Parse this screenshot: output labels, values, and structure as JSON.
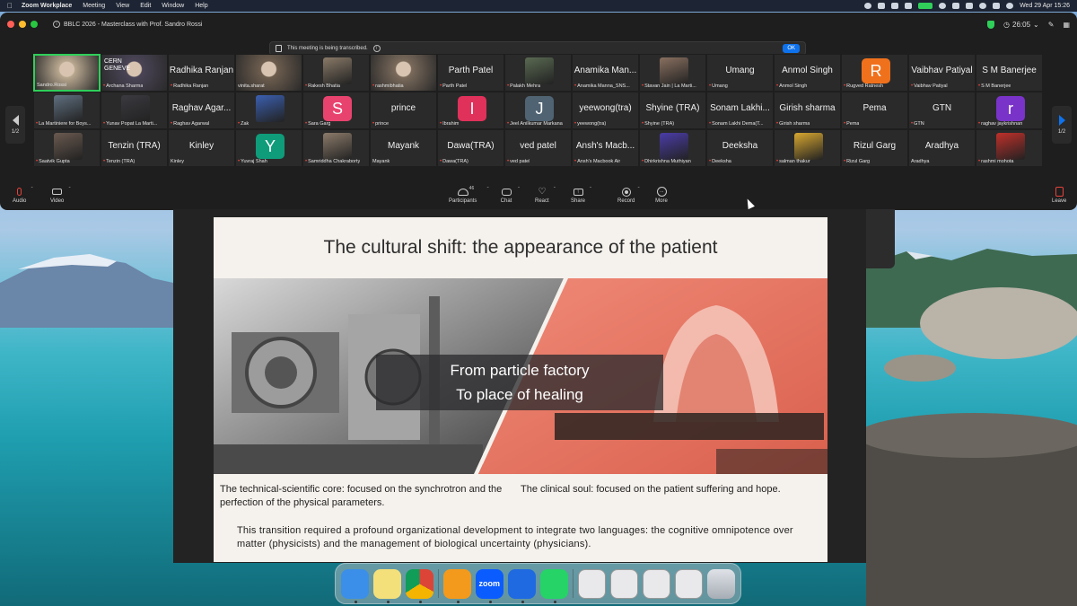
{
  "menubar": {
    "app": "Zoom Workplace",
    "items": [
      "Meeting",
      "View",
      "Edit",
      "Window",
      "Help"
    ],
    "datetime": "Wed 29 Apr  15:26"
  },
  "window": {
    "title": "BBLC 2026 - Masterclass with Prof. Sandro Rossi",
    "timer": "26:05"
  },
  "banner": {
    "text": "This meeting is being transcribed.",
    "ok": "OK"
  },
  "pager": {
    "left": "1/2",
    "right": "1/2"
  },
  "participants": [
    {
      "label": "Sandro.Rossi",
      "kind": "video",
      "color": "#b9a890",
      "active": true,
      "muted": false
    },
    {
      "label": "Archana Sharma",
      "kind": "video",
      "color": "#4a4456",
      "muted": true,
      "overlay": "CERN GENEVE"
    },
    {
      "label": "Radhika Ranjan",
      "kind": "name",
      "big": "Radhika Ranjan",
      "muted": true
    },
    {
      "label": "vinita.sharat",
      "kind": "video",
      "color": "#6d5d4e",
      "muted": false
    },
    {
      "label": "Rakesh Bhatia",
      "kind": "photo",
      "color": "#8a7a68",
      "muted": true
    },
    {
      "label": "rashmibhatia",
      "kind": "video",
      "color": "#7a6a5b",
      "muted": true
    },
    {
      "label": "Parth Patel",
      "kind": "name",
      "big": "Parth Patel",
      "muted": true
    },
    {
      "label": "Palakh Mehra",
      "kind": "photo",
      "color": "#5a6a52",
      "muted": true
    },
    {
      "label": "Anamika Manna_SNS...",
      "kind": "name",
      "big": "Anamika Man...",
      "muted": true
    },
    {
      "label": "Stavan Jain | La Marti...",
      "kind": "photo",
      "color": "#8a7060",
      "muted": true
    },
    {
      "label": "Umang",
      "kind": "name",
      "big": "Umang",
      "muted": true
    },
    {
      "label": "Anmol Singh",
      "kind": "name",
      "big": "Anmol Singh",
      "muted": true
    },
    {
      "label": "Rugved Ratnesh",
      "kind": "avatar",
      "letter": "R",
      "color": "#f0711c",
      "muted": true
    },
    {
      "label": "Vaibhav Patiyal",
      "kind": "name",
      "big": "Vaibhav Patiyal",
      "muted": true
    },
    {
      "label": "S M Banerjee",
      "kind": "name",
      "big": "S M Banerjee",
      "muted": true
    },
    {
      "label": "La Martiniere for Boys...",
      "kind": "photo",
      "color": "#5f6f80",
      "muted": true
    },
    {
      "label": "Yunav Popat La Marti...",
      "kind": "photo",
      "color": "#3a3a40",
      "muted": true
    },
    {
      "label": "Raghav Agarwal",
      "kind": "name",
      "big": "Raghav Agar...",
      "muted": true
    },
    {
      "label": "Zak",
      "kind": "photo",
      "color": "#3b5fb0",
      "muted": true
    },
    {
      "label": "Sara Garg",
      "kind": "avatar",
      "letter": "S",
      "color": "#e8436e",
      "muted": true
    },
    {
      "label": "prince",
      "kind": "name",
      "big": "prince",
      "muted": true
    },
    {
      "label": "Ibrahim",
      "kind": "avatar",
      "letter": "I",
      "color": "#e0315a",
      "muted": true
    },
    {
      "label": "Jeel Anilkumar Markana",
      "kind": "avatar",
      "letter": "J",
      "color": "#4f6373",
      "muted": true
    },
    {
      "label": "yeewong(tra)",
      "kind": "name",
      "big": "yeewong(tra)",
      "muted": true
    },
    {
      "label": "Shyine (TRA)",
      "kind": "name",
      "big": "Shyine (TRA)",
      "muted": true
    },
    {
      "label": "Sonam Lakhi Dema(T...",
      "kind": "name",
      "big": "Sonam Lakhi...",
      "muted": true
    },
    {
      "label": "Girish sharma",
      "kind": "name",
      "big": "Girish sharma",
      "muted": true
    },
    {
      "label": "Pema",
      "kind": "name",
      "big": "Pema",
      "muted": true
    },
    {
      "label": "GTN",
      "kind": "name",
      "big": "GTN",
      "muted": true
    },
    {
      "label": "raghav jaykrishnan",
      "kind": "avatar",
      "letter": "r",
      "color": "#7a33c8",
      "muted": true
    },
    {
      "label": "Saatvik Gupta",
      "kind": "photo",
      "color": "#6a5a50",
      "muted": true
    },
    {
      "label": "Tenzin (TRA)",
      "kind": "name",
      "big": "Tenzin (TRA)",
      "muted": true
    },
    {
      "label": "Kinley",
      "kind": "name",
      "big": "Kinley",
      "muted": false
    },
    {
      "label": "Yuvraj Shah",
      "kind": "avatar",
      "letter": "Y",
      "color": "#0f9c7a",
      "muted": true
    },
    {
      "label": "Samriddha Chakraborty",
      "kind": "photo",
      "color": "#8c7b6a",
      "muted": true
    },
    {
      "label": "Mayank",
      "kind": "name",
      "big": "Mayank",
      "muted": false
    },
    {
      "label": "Dawa(TRA)",
      "kind": "name",
      "big": "Dawa(TRA)",
      "muted": true
    },
    {
      "label": "ved patel",
      "kind": "name",
      "big": "ved patel",
      "muted": true
    },
    {
      "label": "Ansh's Macbook Air",
      "kind": "name",
      "big": "Ansh's Macb...",
      "muted": true
    },
    {
      "label": "Dhirkrishna Muthiyan",
      "kind": "photo",
      "color": "#4a3ca8",
      "muted": true
    },
    {
      "label": "Deeksha",
      "kind": "name",
      "big": "Deeksha",
      "muted": true
    },
    {
      "label": "salman thakur",
      "kind": "photo",
      "color": "#d8a830",
      "muted": true
    },
    {
      "label": "Rizul Garg",
      "kind": "name",
      "big": "Rizul Garg",
      "muted": true
    },
    {
      "label": "Aradhya",
      "kind": "name",
      "big": "Aradhya",
      "muted": false
    },
    {
      "label": "rashmi mohota",
      "kind": "photo",
      "color": "#c0302a",
      "muted": true
    }
  ],
  "toolbar": {
    "audio": "Audio",
    "video": "Video",
    "participants": "Participants",
    "participants_count": "46",
    "chat": "Chat",
    "react": "React",
    "share": "Share",
    "record": "Record",
    "more": "More",
    "leave": "Leave"
  },
  "slide": {
    "title": "The cultural shift: the appearance of the patient",
    "caption_line1": "From particle factory",
    "caption_line2": "To place of healing",
    "left_text": "The technical-scientific core: focused on the synchrotron and the perfection of the physical parameters.",
    "right_text": "The clinical soul: focused on the patient suffering and hope.",
    "bottom_text": "This transition required a profound organizational development to integrate two languages: the cognitive omnipotence over matter (physicists) and the management of biological uncertainty (physicians)."
  },
  "dock": {
    "apps": [
      {
        "name": "finder",
        "color": "#3b8fe8",
        "label": ""
      },
      {
        "name": "notes",
        "color": "#f4e07a",
        "label": ""
      },
      {
        "name": "chrome",
        "color": "#ffffff",
        "label": ""
      },
      {
        "name": "pages",
        "color": "#f39a1c",
        "label": ""
      },
      {
        "name": "zoom",
        "color": "#0b5cff",
        "label": "zoom"
      },
      {
        "name": "quicktime",
        "color": "#1f6ae0",
        "label": ""
      },
      {
        "name": "whatsapp",
        "color": "#25d366",
        "label": ""
      }
    ]
  }
}
